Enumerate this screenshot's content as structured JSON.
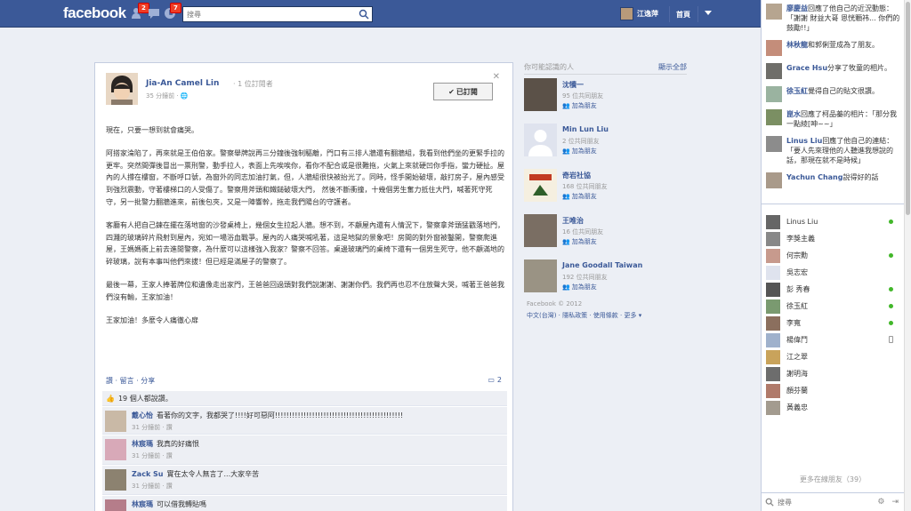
{
  "topbar": {
    "logo": "facebook",
    "friend_requests_badge": "2",
    "notifications_badge": "7",
    "search_placeholder": "搜尋",
    "user_name": "江逸萍",
    "home_label": "首頁"
  },
  "post": {
    "author": "Jia-An Camel Lin",
    "subscribers": "· 1 位訂閱者",
    "time": "35 分鐘前 · 🌐",
    "subscribed_label": "已訂閱",
    "paragraphs": [
      "現在，只要一想到就會痛哭。",
      "阿搭家淪陷了，再來就是王伯伯家。警察舉牌說再三分鐘後強制驅離，門口有三排人牆還有翻牆組，我看到他們坐的更緊手拉的更牢。突然間彈後冒出一票刑警，動手拉人，表面上先唉唉你，看你不配合或是很難拖，火氣上來就硬凹你手指，蠻力硬扯。屋內的人撐在樓窗，不斷呼口號，為窗外的同志加油打氣，但，人牆組很快被抬光了。同時，怪手開始破壞，敲打房子，屋內感受到強烈震動，守著樓梯口的人受傷了。警察用斧頭和鐵鎚破壞大門， 然後不斷衝撞，十幾個男生奮力抵住大門，喊著死守死守，另一批警力翻牆進來，前後包夾，又是一陣響幹，拖走我們陽台的守護者。",
      "客廳有人把自己鍊在擺在落地窗的沙發桌椅上，幾個女生拉起人牆。想不到，不顧屋內還有人情況下，警察拿斧頭猛戳落地門，四濺的玻璃碎片飛射到屋內，宛如一場浴血戰爭。屋內的人痛哭喊吼著，這是地獄的景象吧！房間的對外窗被鑿開，警察爬進屋，王媽媽衝上前去進閒警察，為什麼可以這樣強入我家？警察不回答。桌邊玻璃門的桌椅下還有一個男生死守，他不顧滿地的碎玻璃，說有本事叫他們來拔！但已經是滿屋子的警察了。",
      "最後一幕，王家人捧著牌位和遺像走出家門，王爸爸回過頭對我們說謝謝、謝謝你們。我們再也忍不住放聲大哭，喊著王爸爸我們沒有輸，王家加油！",
      "王家加油！多麼令人痛徹心扉"
    ],
    "actions": "讚 · 留言 · 分享",
    "comment_count": "2",
    "likes_text": "19 個人都說讚。",
    "comments": [
      {
        "name": "戴心怡",
        "text": "看著你的文字，我都哭了!!!!好可惡阿!!!!!!!!!!!!!!!!!!!!!!!!!!!!!!!!!!!!!!!!!!!!!",
        "meta": "31 分鐘前 · 讚"
      },
      {
        "name": "林宸瑪",
        "text": "我真的好痛恨",
        "meta": "31 分鐘前 · 讚"
      },
      {
        "name": "Zack Su",
        "text": "實在太令人無言了...大家辛苦",
        "meta": "31 分鐘前 · 讚"
      },
      {
        "name": "林宸瑪",
        "text": "可以借我轉貼嗎",
        "meta": ""
      }
    ]
  },
  "pymk": {
    "title": "你可能認識的人",
    "see_all": "顯示全部",
    "add_friend": "加為朋友",
    "people": [
      {
        "name": "沈犢一",
        "mutual": "95 位共同朋友"
      },
      {
        "name": "Min Lun Liu",
        "mutual": "2 位共同朋友"
      },
      {
        "name": "奇岩社協",
        "mutual": "168 位共同朋友"
      },
      {
        "name": "王唯治",
        "mutual": "16 位共同朋友"
      },
      {
        "name": "Jane Goodall Taiwan",
        "mutual": "192 位共同朋友"
      }
    ]
  },
  "footer": {
    "copyright": "Facebook © 2012",
    "links": "中文(台灣) · 隱私政策 · 使用條款 · 更多 ▾"
  },
  "ticker": [
    {
      "name": "廖慶益",
      "text": "回應了他自己的近況動態：「謝謝 財益大哥 恩恍顆祎... 你們的鼓勵!!」"
    },
    {
      "name": "林秋龍",
      "text": "和郭俐萱成為了朋友。"
    },
    {
      "name": "Grace Hsu",
      "text": "分享了牧童的相片。"
    },
    {
      "name": "徐玉紅",
      "text": "覺得自己的貼文很讚。"
    },
    {
      "name": "崑水",
      "text": "回應了柯品蓁的相片：「那分我一點綾[呻~~」"
    },
    {
      "name": "Linus Liu",
      "text": "回應了他自己的連結：「要人先來理他的人聽進我想說的話，那現在就不是時候」"
    },
    {
      "name": "Yachun Chang",
      "text": "說得好的話"
    }
  ],
  "chat": {
    "friends": [
      {
        "name": "Linus Liu",
        "status": "online"
      },
      {
        "name": "李獎主義",
        "status": ""
      },
      {
        "name": "何宗勳",
        "status": "online"
      },
      {
        "name": "吳志宏",
        "status": ""
      },
      {
        "name": "彭 秀春",
        "status": "online"
      },
      {
        "name": "徐玉紅",
        "status": "online"
      },
      {
        "name": "李寬",
        "status": "online"
      },
      {
        "name": "楊偉鬥",
        "status": "mobile"
      },
      {
        "name": "江之翠",
        "status": ""
      },
      {
        "name": "謝明海",
        "status": ""
      },
      {
        "name": "顏芬蘭",
        "status": ""
      },
      {
        "name": "黃義忠",
        "status": ""
      }
    ],
    "more_text": "更多在線朋友",
    "more_count": "（39）",
    "search_placeholder": "搜尋"
  }
}
